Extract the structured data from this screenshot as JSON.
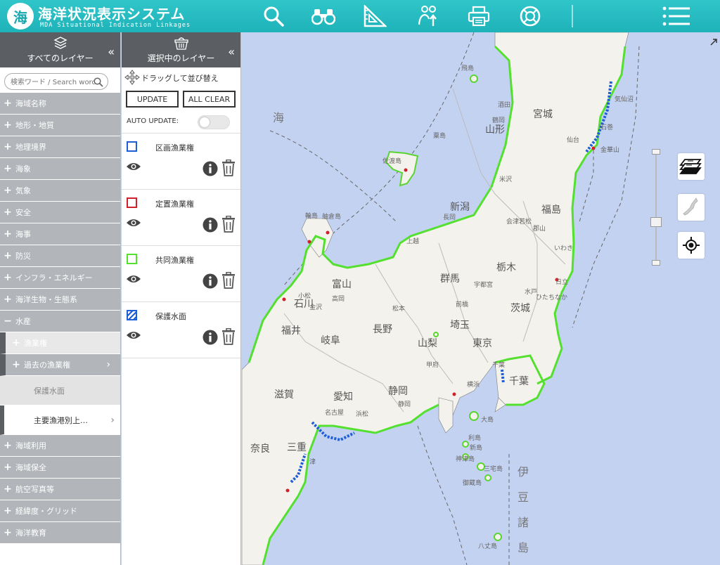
{
  "header": {
    "logo_text": "海",
    "title": "海洋状況表示システム",
    "subtitle": "MDA Situational Indication Linkages"
  },
  "left_panel": {
    "heading": "すべてのレイヤー",
    "collapse": "«",
    "search_placeholder": "検索ワード / Search word",
    "categories": [
      {
        "label": "海域名称",
        "sign": "+"
      },
      {
        "label": "地形・地質",
        "sign": "+"
      },
      {
        "label": "地理境界",
        "sign": "+"
      },
      {
        "label": "海象",
        "sign": "+"
      },
      {
        "label": "気象",
        "sign": "+"
      },
      {
        "label": "安全",
        "sign": "+"
      },
      {
        "label": "海事",
        "sign": "+"
      },
      {
        "label": "防災",
        "sign": "+"
      },
      {
        "label": "インフラ・エネルギー",
        "sign": "+"
      },
      {
        "label": "海洋生物・生態系",
        "sign": "+"
      },
      {
        "label": "水産",
        "sign": "−"
      }
    ],
    "sub_items": {
      "fishing_rights": {
        "label": "漁業権",
        "sign": "+"
      },
      "past_fishing_rights": {
        "label": "過去の漁業権",
        "sign": "+",
        "chevron": "›"
      },
      "protected_water": {
        "label": "保護水面"
      },
      "major_ports": {
        "label": "主要漁港別上…",
        "chevron": "›"
      }
    },
    "categories_bottom": [
      {
        "label": "海域利用",
        "sign": "+"
      },
      {
        "label": "海域保全",
        "sign": "+"
      },
      {
        "label": "航空写真等",
        "sign": "+"
      },
      {
        "label": "経緯度・グリッド",
        "sign": "+"
      },
      {
        "label": "海洋教育",
        "sign": "+"
      }
    ]
  },
  "selected_panel": {
    "heading": "選択中のレイヤー",
    "collapse": "«",
    "drag_label": "ドラッグして並び替え",
    "update_label": "UPDATE",
    "clear_label": "ALL CLEAR",
    "auto_update_label": "AUTO UPDATE:",
    "auto_update_on": false,
    "layers": [
      {
        "name": "区画漁業権",
        "color": "#1f5fd6",
        "style": "solid"
      },
      {
        "name": "定置漁業権",
        "color": "#d0202a",
        "style": "solid"
      },
      {
        "name": "共同漁業権",
        "color": "#53e02e",
        "style": "solid"
      },
      {
        "name": "保護水面",
        "color": "#1f5fd6",
        "style": "hatched"
      }
    ]
  },
  "map": {
    "prefectures": [
      {
        "label": "山形"
      },
      {
        "label": "宮城"
      },
      {
        "label": "新潟"
      },
      {
        "label": "福島"
      },
      {
        "label": "富山"
      },
      {
        "label": "石川"
      },
      {
        "label": "群馬"
      },
      {
        "label": "栃木"
      },
      {
        "label": "長野"
      },
      {
        "label": "茨城"
      },
      {
        "label": "福井"
      },
      {
        "label": "岐阜"
      },
      {
        "label": "埼玉"
      },
      {
        "label": "山梨"
      },
      {
        "label": "東京"
      },
      {
        "label": "千葉"
      },
      {
        "label": "愛知"
      },
      {
        "label": "静岡"
      },
      {
        "label": "滋賀"
      },
      {
        "label": "三重"
      },
      {
        "label": "奈良"
      }
    ],
    "sea_labels": [
      {
        "label": "海"
      }
    ],
    "izu_labels": [
      {
        "label": "伊"
      },
      {
        "label": "豆"
      },
      {
        "label": "諸"
      },
      {
        "label": "島"
      }
    ],
    "small_labels": [
      {
        "label": "佐渡島"
      },
      {
        "label": "粟島"
      },
      {
        "label": "飛島"
      },
      {
        "label": "酒田"
      },
      {
        "label": "鶴岡"
      },
      {
        "label": "米沢"
      },
      {
        "label": "会津若松"
      },
      {
        "label": "郡山"
      },
      {
        "label": "長岡"
      },
      {
        "label": "上越"
      },
      {
        "label": "松本"
      },
      {
        "label": "前橋"
      },
      {
        "label": "宇都宮"
      },
      {
        "label": "水戸"
      },
      {
        "label": "いわき"
      },
      {
        "label": "日立"
      },
      {
        "label": "舳倉島"
      },
      {
        "label": "輪島"
      },
      {
        "label": "金沢"
      },
      {
        "label": "高岡"
      },
      {
        "label": "小松"
      },
      {
        "label": "甲府"
      },
      {
        "label": "静岡"
      },
      {
        "label": "浜松"
      },
      {
        "label": "名古屋"
      },
      {
        "label": "津"
      },
      {
        "label": "横浜"
      },
      {
        "label": "大島"
      },
      {
        "label": "利島"
      },
      {
        "label": "新島"
      },
      {
        "label": "神津島"
      },
      {
        "label": "三宅島"
      },
      {
        "label": "御蔵島"
      },
      {
        "label": "八丈島"
      },
      {
        "label": "ひたちなか"
      },
      {
        "label": "金華山"
      },
      {
        "label": "気仙沼"
      },
      {
        "label": "仙台"
      },
      {
        "label": "石巻"
      },
      {
        "label": "千葉"
      }
    ]
  }
}
